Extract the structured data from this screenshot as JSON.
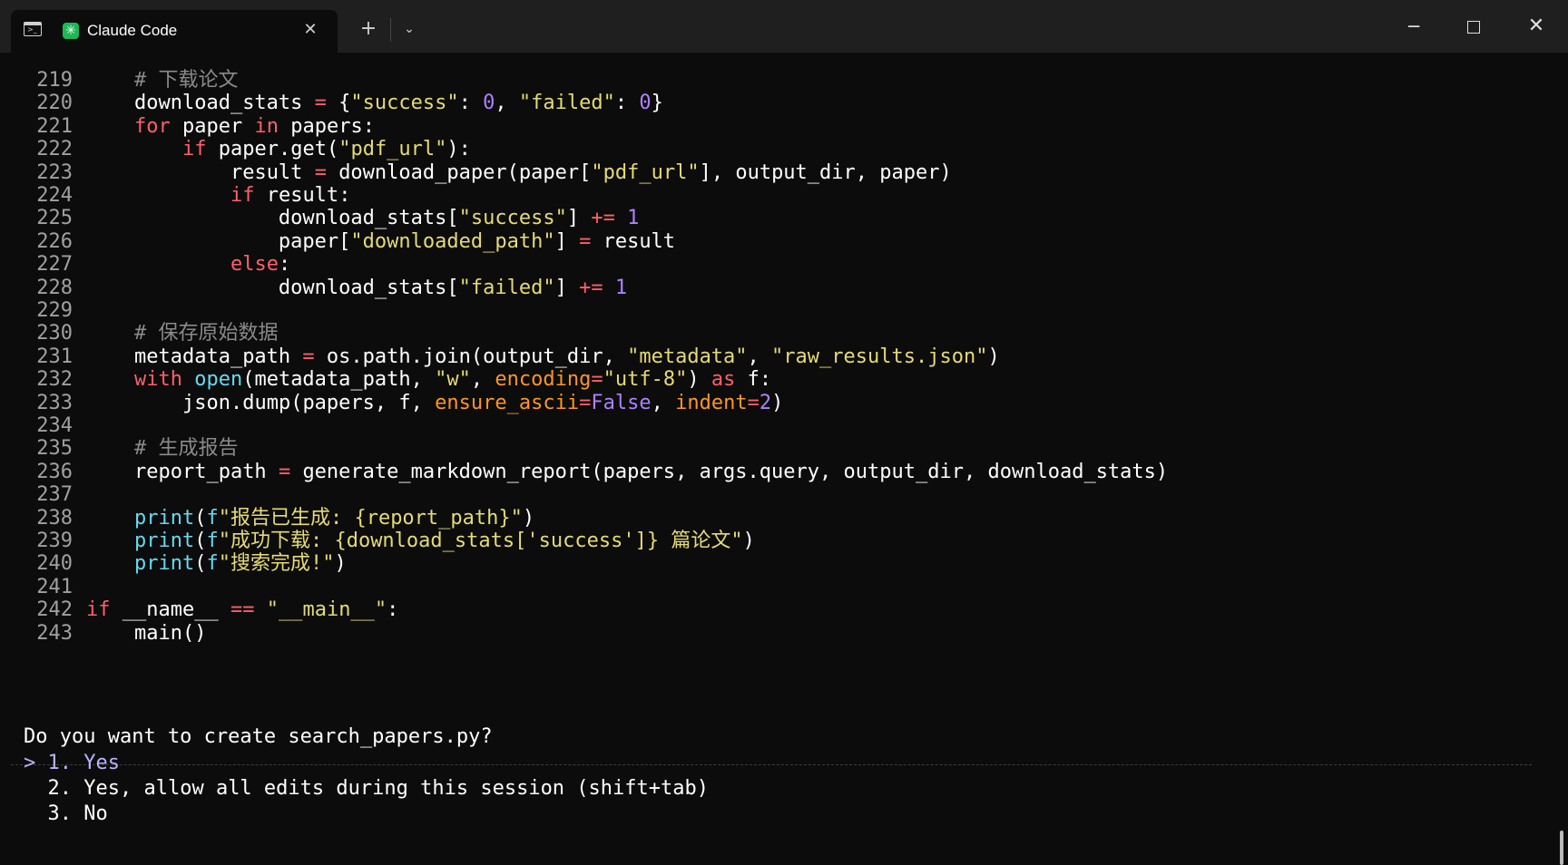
{
  "window": {
    "tab_title": "Claude Code",
    "icons": [
      "terminal-icon",
      "claude-app-icon",
      "close-icon",
      "plus-icon",
      "chevron-down-icon",
      "minimize-icon",
      "maximize-icon",
      "close-window-icon"
    ]
  },
  "code_lines": [
    {
      "n": "219",
      "t": "    # 下载论文"
    },
    {
      "n": "220",
      "t": "    download_stats = {\"success\": 0, \"failed\": 0}"
    },
    {
      "n": "221",
      "t": "    for paper in papers:"
    },
    {
      "n": "222",
      "t": "        if paper.get(\"pdf_url\"):"
    },
    {
      "n": "223",
      "t": "            result = download_paper(paper[\"pdf_url\"], output_dir, paper)"
    },
    {
      "n": "224",
      "t": "            if result:"
    },
    {
      "n": "225",
      "t": "                download_stats[\"success\"] += 1"
    },
    {
      "n": "226",
      "t": "                paper[\"downloaded_path\"] = result"
    },
    {
      "n": "227",
      "t": "            else:"
    },
    {
      "n": "228",
      "t": "                download_stats[\"failed\"] += 1"
    },
    {
      "n": "229",
      "t": ""
    },
    {
      "n": "230",
      "t": "    # 保存原始数据"
    },
    {
      "n": "231",
      "t": "    metadata_path = os.path.join(output_dir, \"metadata\", \"raw_results.json\")"
    },
    {
      "n": "232",
      "t": "    with open(metadata_path, \"w\", encoding=\"utf-8\") as f:"
    },
    {
      "n": "233",
      "t": "        json.dump(papers, f, ensure_ascii=False, indent=2)"
    },
    {
      "n": "234",
      "t": ""
    },
    {
      "n": "235",
      "t": "    # 生成报告"
    },
    {
      "n": "236",
      "t": "    report_path = generate_markdown_report(papers, args.query, output_dir, download_stats)"
    },
    {
      "n": "237",
      "t": ""
    },
    {
      "n": "238",
      "t": "    print(f\"报告已生成: {report_path}\")"
    },
    {
      "n": "239",
      "t": "    print(f\"成功下载: {download_stats['success']} 篇论文\")"
    },
    {
      "n": "240",
      "t": "    print(f\"搜索完成!\")"
    },
    {
      "n": "241",
      "t": ""
    },
    {
      "n": "242",
      "t": "if __name__ == \"__main__\":"
    },
    {
      "n": "243",
      "t": "    main()"
    }
  ],
  "prompt": {
    "question": "Do you want to create search_papers.py?",
    "cursor": ">",
    "options": [
      {
        "num": "1.",
        "label": "Yes"
      },
      {
        "num": "2.",
        "label": "Yes, allow all edits during this session (shift+tab)"
      },
      {
        "num": "3.",
        "label": "No"
      }
    ]
  },
  "colors": {
    "background": "#0c0c0c",
    "keyword": "#ff5f6a",
    "string": "#e6db74",
    "number": "#ae81ff",
    "builtin": "#66d9ef",
    "kwarg": "#fd971f",
    "comment": "#8a8a8a",
    "selection": "#b9b4ff"
  }
}
